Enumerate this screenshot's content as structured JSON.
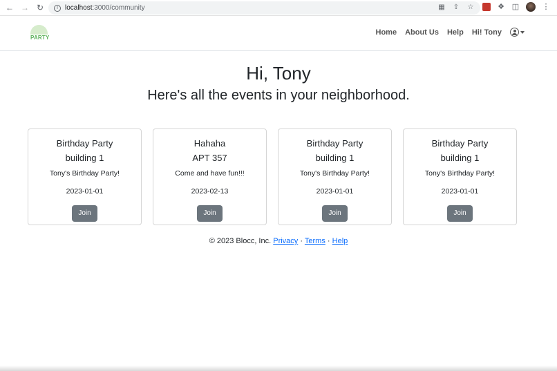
{
  "browser": {
    "url_host": "localhost",
    "url_path": ":3000/community"
  },
  "navbar": {
    "logo_text": "PARTY",
    "links": [
      "Home",
      "About Us",
      "Help",
      "Hi! Tony"
    ]
  },
  "main": {
    "greeting": "Hi, Tony",
    "subheading": "Here's all the events in your neighborhood."
  },
  "events": [
    {
      "title": "Birthday Party",
      "location": "building 1",
      "description": "Tony's Birthday Party!",
      "date": "2023-01-01",
      "button": "Join"
    },
    {
      "title": "Hahaha",
      "location": "APT 357",
      "description": "Come and have fun!!!",
      "date": "2023-02-13",
      "button": "Join"
    },
    {
      "title": "Birthday Party",
      "location": "building 1",
      "description": "Tony's Birthday Party!",
      "date": "2023-01-01",
      "button": "Join"
    },
    {
      "title": "Birthday Party",
      "location": "building 1",
      "description": "Tony's Birthday Party!",
      "date": "2023-01-01",
      "button": "Join"
    }
  ],
  "footer": {
    "copyright": "© 2023 Blocc, Inc.",
    "privacy": "Privacy",
    "terms": "Terms",
    "help": "Help",
    "separator": "·"
  },
  "icons": {
    "back": "back-arrow-icon",
    "forward": "forward-arrow-icon",
    "reload": "reload-icon",
    "info": "site-info-icon",
    "translate": "translate-icon",
    "share": "share-icon",
    "bookmark": "star-icon",
    "extension": "puzzle-icon",
    "sidepanel": "side-panel-icon",
    "menu": "kebab-menu-icon",
    "user": "user-circle-icon"
  }
}
